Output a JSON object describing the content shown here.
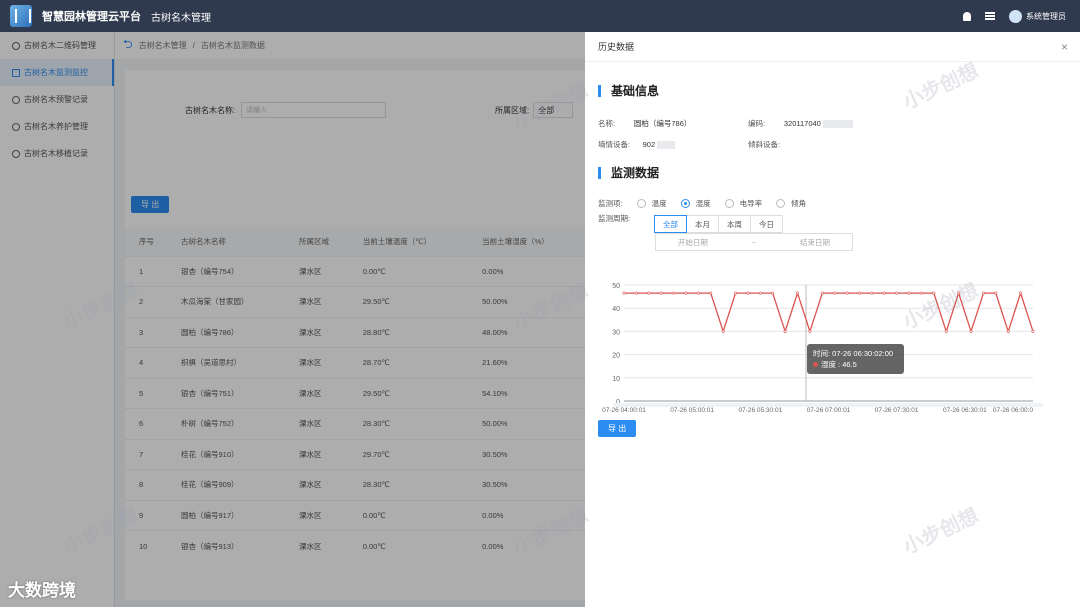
{
  "topbar": {
    "app_title": "智慧园林管理云平台",
    "module_title": "古树名木管理",
    "user_name": "系统管理员"
  },
  "sidebar": {
    "items": [
      {
        "label": "古树名木二维码管理"
      },
      {
        "label": "古树名木监测监控"
      },
      {
        "label": "古树名木预警记录"
      },
      {
        "label": "古树名木养护管理"
      },
      {
        "label": "古树名木移植记录"
      }
    ]
  },
  "main": {
    "breadcrumb": {
      "root": "古树名木管理",
      "sep": "/",
      "current": "古树名木监测数据"
    },
    "search": {
      "name_label": "古树名木名称:",
      "name_placeholder": "请输入",
      "area_label": "所属区域:",
      "area_value": "全部"
    },
    "export_label": "导 出",
    "columns": [
      "序号",
      "古树名木名称",
      "所属区域",
      "当前土壤温度（℃）",
      "当前土壤湿度（%）"
    ],
    "rows": [
      [
        "1",
        "银杏（编号754）",
        "溧水区",
        "0.00℃",
        "0.00%"
      ],
      [
        "2",
        "木瓜海棠（甘家园）",
        "溧水区",
        "29.50℃",
        "50.00%"
      ],
      [
        "3",
        "圆柏（编号786）",
        "溧水区",
        "28.80℃",
        "48.00%"
      ],
      [
        "4",
        "枳椇（吴道思村）",
        "溧水区",
        "28.70℃",
        "21.60%"
      ],
      [
        "5",
        "银杏（编号751）",
        "溧水区",
        "29.50℃",
        "54.10%"
      ],
      [
        "6",
        "朴树（编号752）",
        "溧水区",
        "28.30℃",
        "50.00%"
      ],
      [
        "7",
        "桂花（编号910）",
        "溧水区",
        "29.70℃",
        "30.50%"
      ],
      [
        "8",
        "桂花（编号909）",
        "溧水区",
        "28.30℃",
        "30.50%"
      ],
      [
        "9",
        "圆柏（编号917）",
        "溧水区",
        "0.00℃",
        "0.00%"
      ],
      [
        "10",
        "银杏（编号913）",
        "溧水区",
        "0.00℃",
        "0.00%"
      ]
    ]
  },
  "drawer": {
    "title": "历史数据",
    "close": "×",
    "basic_title": "基础信息",
    "name_label": "名称:",
    "name_value": "圆柏（编号786）",
    "code_label": "编码:",
    "code_value": "320117040",
    "device_label": "墒情设备:",
    "device_value": "902",
    "device2_label": "倾斜设备:",
    "monitor_title": "监测数据",
    "item_label": "监测项:",
    "items": [
      "温度",
      "湿度",
      "电导率",
      "倾角"
    ],
    "selected_item": "湿度",
    "period_label": "监测周期:",
    "periods": [
      "全部",
      "本月",
      "本周",
      "今日"
    ],
    "selected_period": "全部",
    "start_placeholder": "开始日期",
    "range_sep": "~",
    "end_placeholder": "结束日期",
    "tooltip_time": "时间: 07-26 06:30:02:00",
    "tooltip_value": "湿度 : 46.5",
    "export_label": "导 出"
  },
  "chart_data": {
    "type": "line",
    "x_ticks": [
      "07-26 04:00:01",
      "07-26 05:00:01",
      "07-26 05:30:01",
      "07-26 07:00:01",
      "07-26 07:30:01",
      "07-26 06:30:01",
      "07-26 06:00:0"
    ],
    "y_ticks": [
      "0",
      "10",
      "20",
      "30",
      "40",
      "50"
    ],
    "ylim": [
      0,
      50
    ],
    "series": [
      {
        "values": [
          46.5,
          46.5,
          46.5,
          46.5,
          46.5,
          46.5,
          46.5,
          46.5,
          30,
          46.5,
          46.5,
          46.5,
          46.5,
          30,
          46.5,
          30,
          46.5,
          46.5,
          46.5,
          46.5,
          46.5,
          46.5,
          46.5,
          46.5,
          46.5,
          46.5,
          30,
          46.5,
          30,
          46.5,
          46.5,
          30,
          46.5,
          30
        ]
      }
    ],
    "color": "#d9534f"
  },
  "watermark": "小步创想",
  "brand": "大数跨境"
}
